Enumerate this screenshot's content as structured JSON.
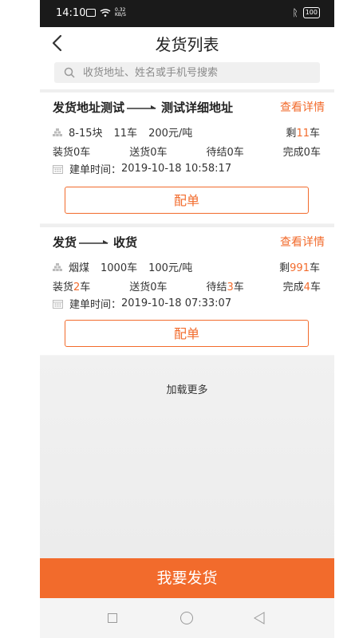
{
  "status_bar": {
    "time": "14:10",
    "net_speed": "0.32\nKB/S",
    "battery": "100"
  },
  "header": {
    "title": "发货列表"
  },
  "search": {
    "placeholder": "收货地址、姓名或手机号搜索"
  },
  "orders": [
    {
      "from": "发货地址测试",
      "to": "测试详细地址",
      "detail_label": "查看详情",
      "cargo": "8-15块",
      "quantity": "11车",
      "price": "200元/吨",
      "remaining_prefix": "剩",
      "remaining_value": "11",
      "remaining_suffix": "车",
      "stats": {
        "loading_label": "装货",
        "loading_value": "0",
        "delivering_label": "送货",
        "delivering_value": "0",
        "settling_label": "待结",
        "settling_value": "0",
        "done_label": "完成",
        "done_value": "0",
        "unit": "车"
      },
      "created_label": "建单时间：",
      "created_time": "2019-10-18 10:58:17",
      "assign_label": "配单"
    },
    {
      "from": "发货",
      "to": "收货",
      "detail_label": "查看详情",
      "cargo": "烟煤",
      "quantity": "1000车",
      "price": "100元/吨",
      "remaining_prefix": "剩",
      "remaining_value": "991",
      "remaining_suffix": "车",
      "stats": {
        "loading_label": "装货",
        "loading_value": "2",
        "delivering_label": "送货",
        "delivering_value": "0",
        "settling_label": "待结",
        "settling_value": "3",
        "done_label": "完成",
        "done_value": "4",
        "unit": "车"
      },
      "created_label": "建单时间：",
      "created_time": "2019-10-18 07:33:07",
      "assign_label": "配单"
    }
  ],
  "load_more": "加载更多",
  "ship_button": "我要发货",
  "colors": {
    "accent": "#f26b2c",
    "status_bar": "#1a1a1a"
  }
}
